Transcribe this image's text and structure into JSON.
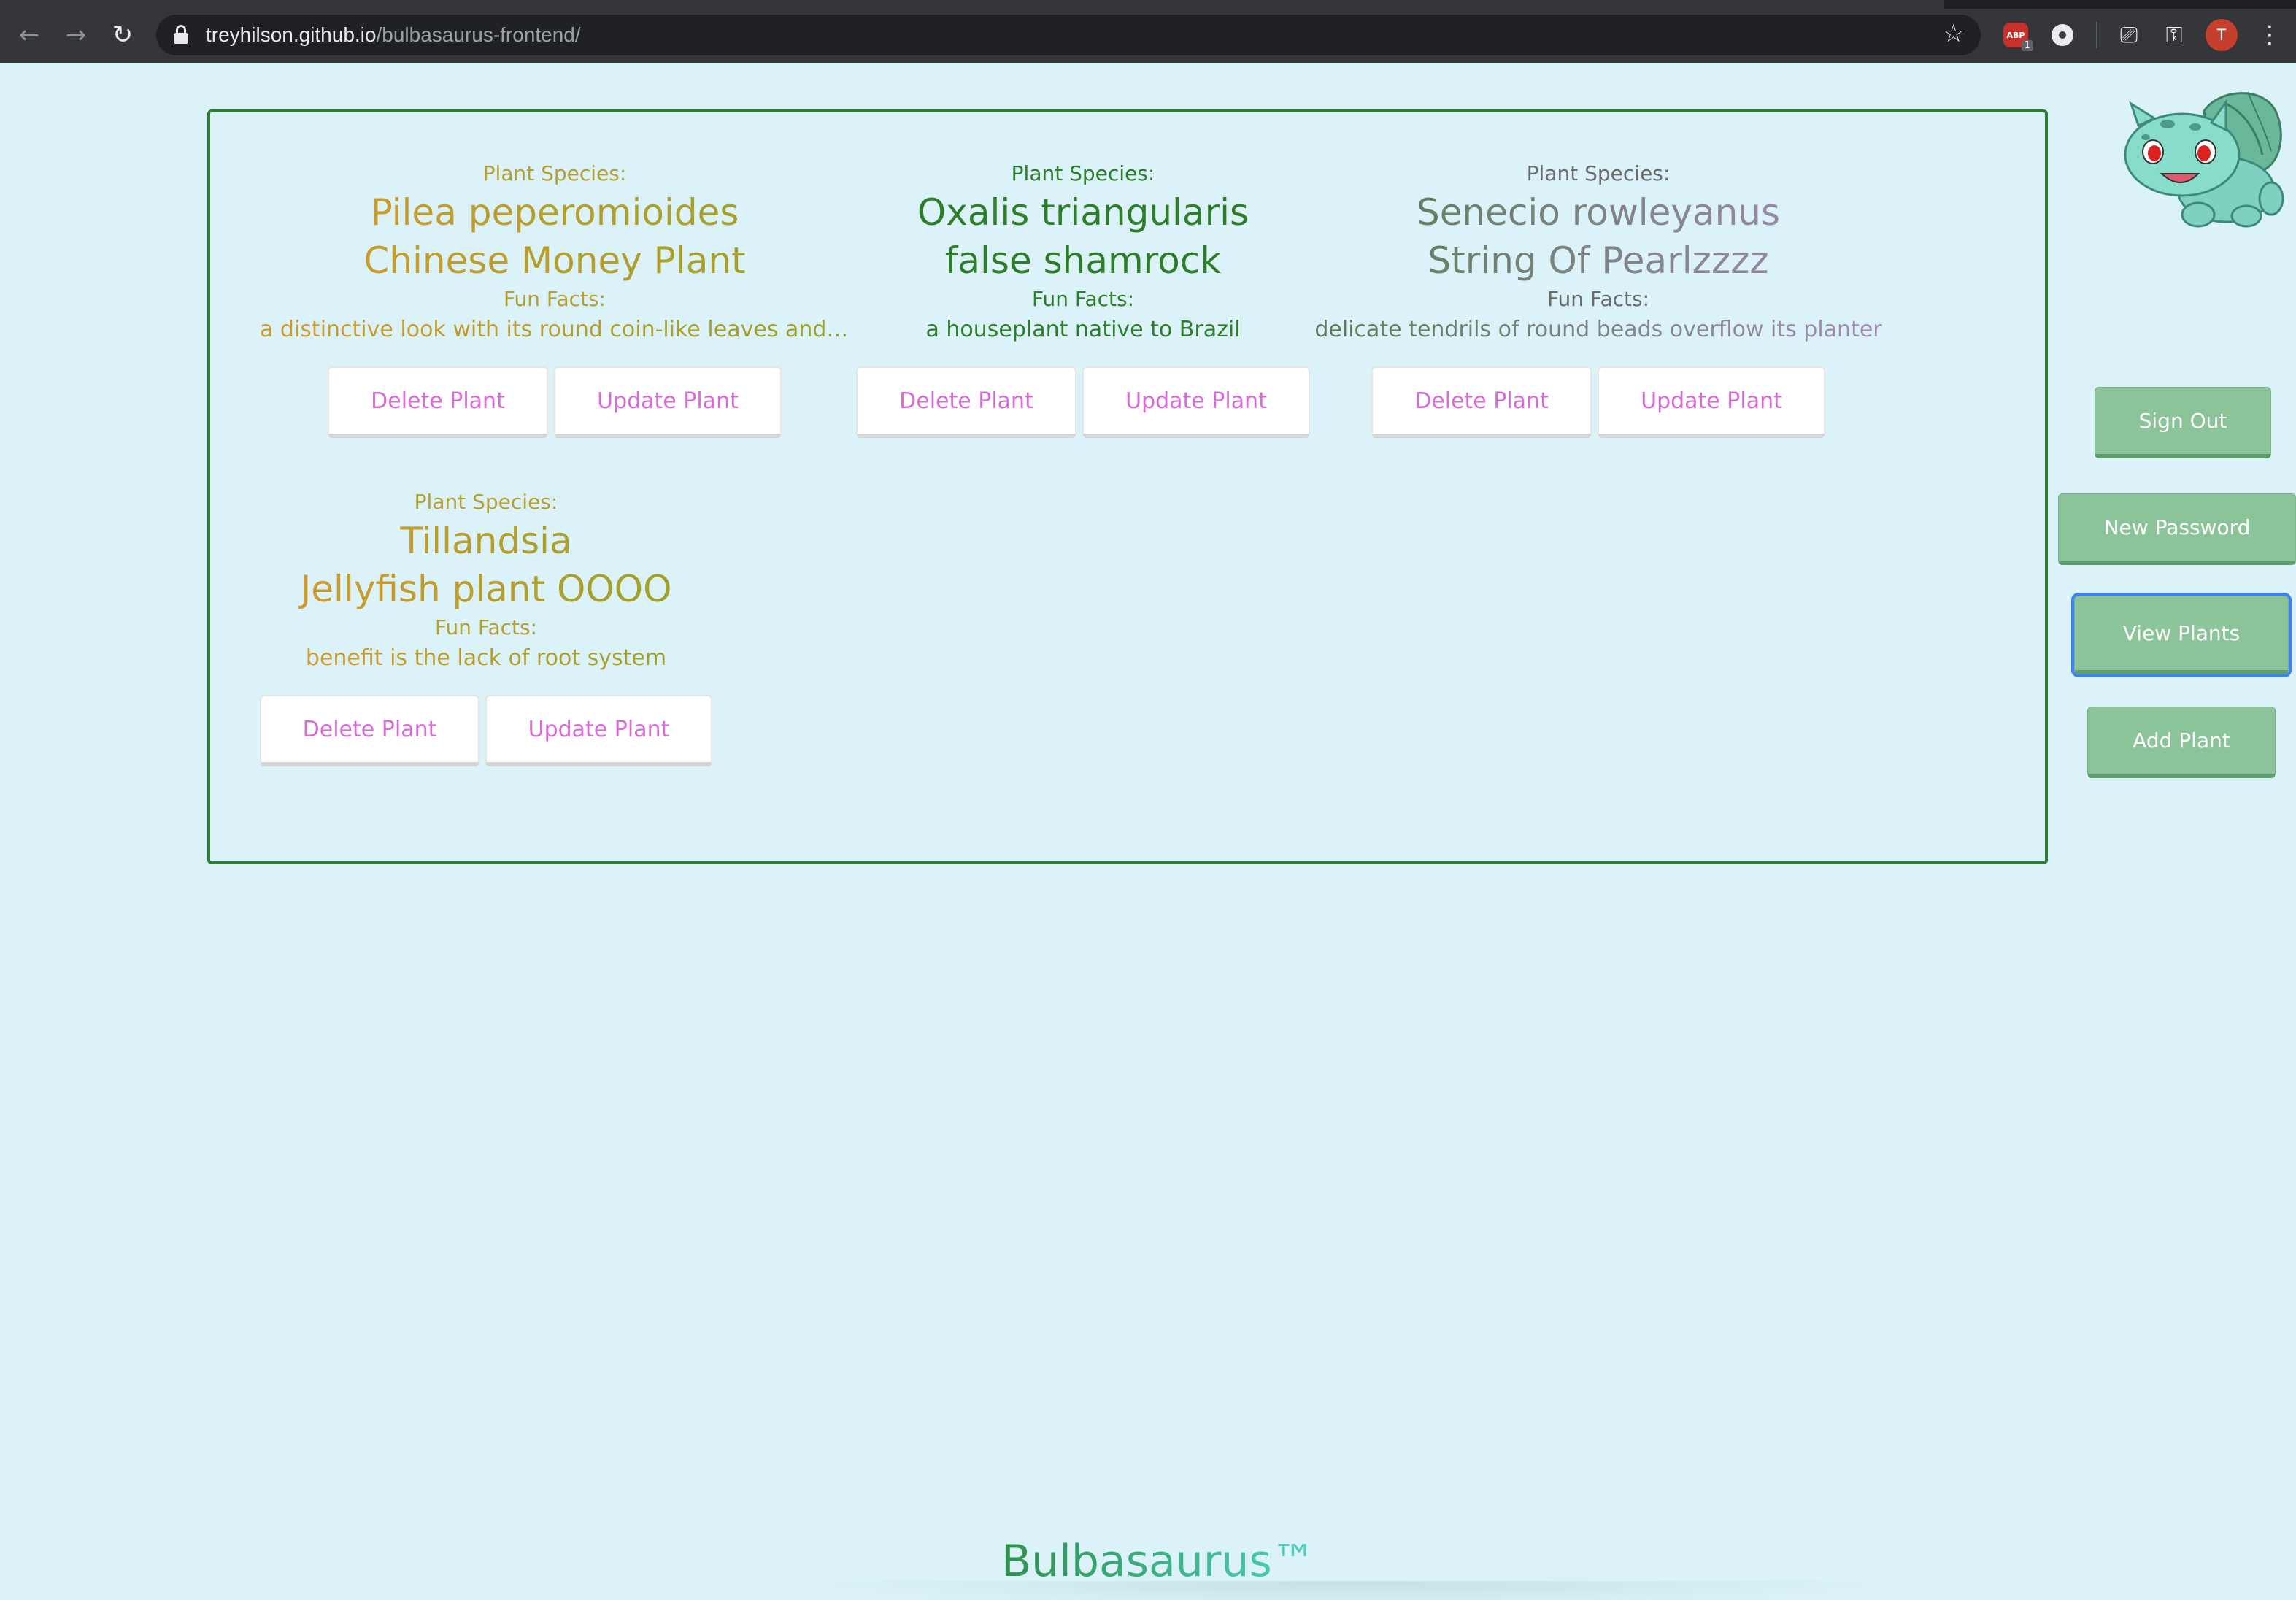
{
  "browser": {
    "url_host": "treyhilson.github.io",
    "url_path": "/bulbasaurus-frontend/",
    "abp_badge": "1",
    "abp_label": "ABP",
    "profile_initial": "T"
  },
  "plants": [
    {
      "species_label": "Plant Species:",
      "scientific_name": "Pilea peperomioides",
      "common_name": "Chinese Money Plant",
      "facts_label": "Fun Facts:",
      "fact": "a distinctive look with its round coin-like leaves and s...",
      "delete_label": "Delete Plant",
      "update_label": "Update Plant"
    },
    {
      "species_label": "Plant Species:",
      "scientific_name": "Oxalis triangularis",
      "common_name": "false shamrock",
      "facts_label": "Fun Facts:",
      "fact": "a houseplant native to Brazil",
      "delete_label": "Delete Plant",
      "update_label": "Update Plant"
    },
    {
      "species_label": "Plant Species:",
      "scientific_name": "Senecio rowleyanus",
      "common_name": "String Of Pearlzzzz",
      "facts_label": "Fun Facts:",
      "fact": "delicate tendrils of round beads overflow its planter",
      "delete_label": "Delete Plant",
      "update_label": "Update Plant"
    },
    {
      "species_label": "Plant Species:",
      "scientific_name": "Tillandsia",
      "common_name": "Jellyfish plant OOOO",
      "facts_label": "Fun Facts:",
      "fact": "benefit is the lack of root system",
      "delete_label": "Delete Plant",
      "update_label": "Update Plant"
    }
  ],
  "nav": {
    "sign_out": "Sign Out",
    "new_password": "New Password",
    "view_plants": "View Plants",
    "add_plant": "Add Plant"
  },
  "footer": {
    "brand": "Bulbasaurus™"
  },
  "colors": {
    "page_bg": "#dbf3f8",
    "panel_border": "#2e7d32",
    "nav_button": "#8cc49a",
    "action_text": "#d96bd6",
    "focus_ring": "#3b82f6"
  }
}
